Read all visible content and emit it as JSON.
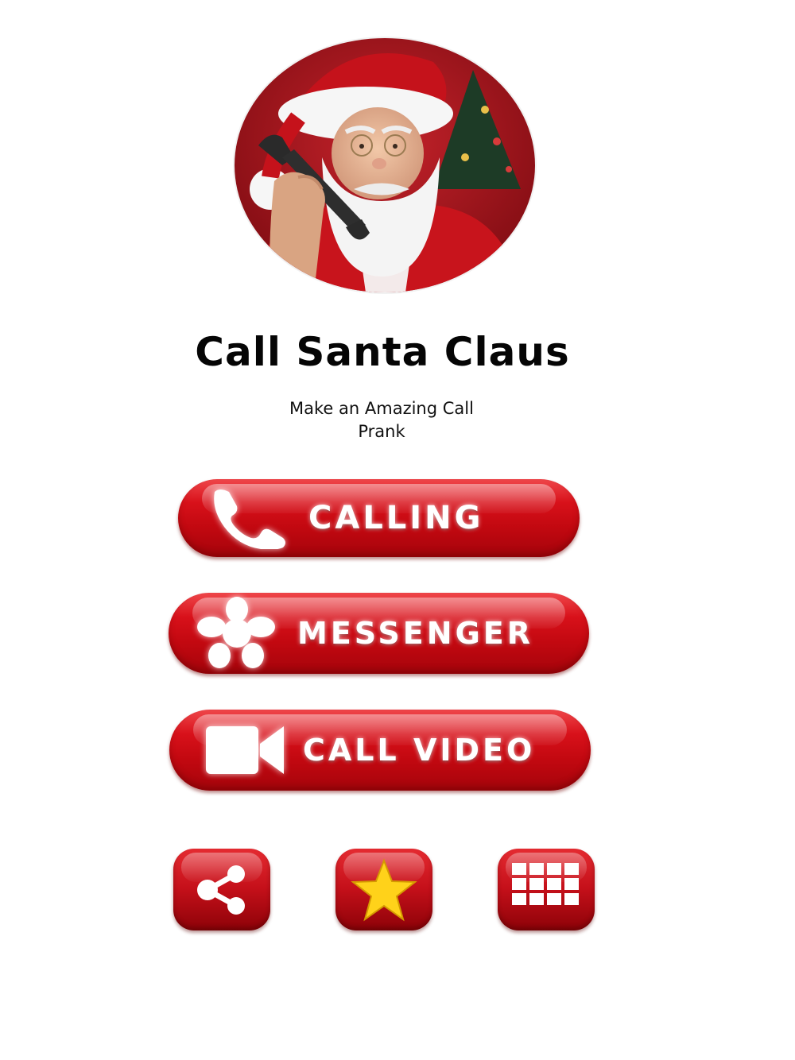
{
  "header": {
    "title": "Call Santa Claus",
    "subtitle_line1": "Make an Amazing Call",
    "subtitle_line2": "Prank"
  },
  "avatar": {
    "icon": "santa-photo"
  },
  "actions": {
    "calling_label": "CALLING",
    "calling_icon": "phone-icon",
    "messenger_label": "MESSENGER",
    "messenger_icon": "flower-chat-icon",
    "video_label": "CALL VIDEO",
    "video_icon": "video-camera-icon"
  },
  "bottom_bar": {
    "share_icon": "share-icon",
    "rate_icon": "star-icon",
    "more_icon": "grid-icon"
  },
  "colors": {
    "accent_red": "#c20810",
    "star_yellow": "#ffd21a",
    "background": "#ffffff",
    "text": "#050505"
  }
}
